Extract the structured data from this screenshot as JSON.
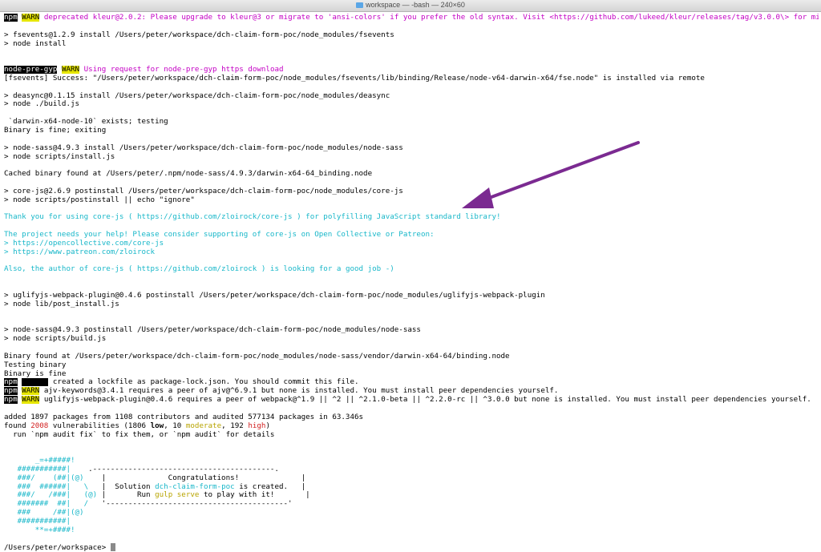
{
  "window": {
    "title": "workspace — -bash — 240×60"
  },
  "badges": {
    "npm": "npm",
    "warn": "WARN",
    "node_pre_gyp": "node-pre-gyp"
  },
  "terminal": {
    "l01_msg": "deprecated kleur@2.0.2: Please upgrade to kleur@3 or migrate to 'ansi-colors' if you prefer the old syntax. Visit <https://github.com/lukeed/kleur/releases/tag/v3.0.0\\> for migration path(s).",
    "l03": "> fsevents@1.2.9 install /Users/peter/workspace/dch-claim-form-poc/node_modules/fsevents",
    "l04": "> node install",
    "l07_msg": "Using request for node-pre-gyp https download",
    "l08": "[fsevents] Success: \"/Users/peter/workspace/dch-claim-form-poc/node_modules/fsevents/lib/binding/Release/node-v64-darwin-x64/fse.node\" is installed via remote",
    "l10": "> deasync@0.1.15 install /Users/peter/workspace/dch-claim-form-poc/node_modules/deasync",
    "l11": "> node ./build.js",
    "l13": " `darwin-x64-node-10` exists; testing",
    "l14": "Binary is fine; exiting",
    "l16": "> node-sass@4.9.3 install /Users/peter/workspace/dch-claim-form-poc/node_modules/node-sass",
    "l17": "> node scripts/install.js",
    "l19": "Cached binary found at /Users/peter/.npm/node-sass/4.9.3/darwin-x64-64_binding.node",
    "l21": "> core-js@2.6.9 postinstall /Users/peter/workspace/dch-claim-form-poc/node_modules/core-js",
    "l22": "> node scripts/postinstall || echo \"ignore\"",
    "l24_a": "Thank you for using core-js ( ",
    "l24_link": "https://github.com/zloirock/core-js",
    "l24_b": " ) for polyfilling JavaScript standard library!",
    "l26": "The project needs your help! Please consider supporting of core-js on Open Collective or Patreon:",
    "l27_p": "> ",
    "l27_link": "https://opencollective.com/core-js",
    "l28_p": "> ",
    "l28_link": "https://www.patreon.com/zloirock",
    "l30_a": "Also, the author of core-js ( ",
    "l30_link": "https://github.com/zloirock",
    "l30_b": " ) is looking for a good job -)",
    "l33": "> uglifyjs-webpack-plugin@0.4.6 postinstall /Users/peter/workspace/dch-claim-form-poc/node_modules/uglifyjs-webpack-plugin",
    "l34": "> node lib/post_install.js",
    "l37": "> node-sass@4.9.3 postinstall /Users/peter/workspace/dch-claim-form-poc/node_modules/node-sass",
    "l38": "> node scripts/build.js",
    "l40": "Binary found at /Users/peter/workspace/dch-claim-form-poc/node_modules/node-sass/vendor/darwin-x64-64/binding.node",
    "l41": "Testing binary",
    "l42": "Binary is fine",
    "l43_msg": " created a lockfile as package-lock.json. You should commit this file.",
    "l44_msg": " ajv-keywords@3.4.1 requires a peer of ajv@^6.9.1 but none is installed. You must install peer dependencies yourself.",
    "l45_msg": " uglifyjs-webpack-plugin@0.4.6 requires a peer of webpack@^1.9 || ^2 || ^2.1.0-beta || ^2.2.0-rc || ^3.0.0 but none is installed. You must install peer dependencies yourself.",
    "l47": "added 1897 packages from 1108 contributors and audited 577134 packages in 63.346s",
    "l48_a": "found ",
    "l48_count": "2008",
    "l48_b": " vulnerabilities (1806 ",
    "l48_low": "low",
    "l48_c": ", 10 ",
    "l48_mod": "moderate",
    "l48_d": ", 192 ",
    "l48_high": "high",
    "l48_e": ")",
    "l49": "  run `npm audit fix` to fix them, or `npm audit` for details",
    "a1": "       _=+#####!",
    "a2_art": "   ###########|    ",
    "a2_box": ".-----------------------------------------.",
    "a3_art": "   ###/    (##|(@)   ",
    "a3_box": " |              Congratulations!              |",
    "a4_art": "   ###  ######|   \\  ",
    "a4_box_a": " |  Solution ",
    "a4_box_name": "dch-claim-form-poc",
    "a4_box_b": " is created.   |",
    "a5_art": "   ###/   /###|   (@)",
    "a5_box_a": " |       Run ",
    "a5_box_cmd": "gulp serve",
    "a5_box_b": " to play with it!       |",
    "a6_art": "   #######  ##|   /  ",
    "a6_box": " '-----------------------------------------'",
    "a7": "   ###     /##|(@)",
    "a8": "   ###########|",
    "a9": "       **=+####!",
    "prompt": "/Users/peter/workspace> "
  }
}
